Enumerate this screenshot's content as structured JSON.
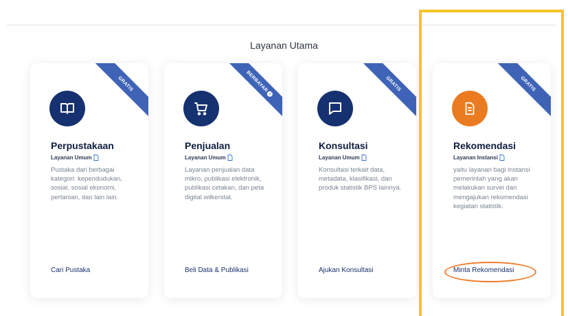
{
  "section": {
    "title": "Layanan Utama"
  },
  "colors": {
    "ribbon": "#3e63b7",
    "navy": "#163170",
    "orange": "#ea7b20",
    "highlight": "#f5c426",
    "annotation": "#ee7d2c"
  },
  "cards": [
    {
      "ribbon": "GRATIS",
      "icon": "book-icon",
      "title": "Perpustakaan",
      "subtitle": "Layanan Umum",
      "description": "Pustaka dari berbagai kategori: kependudukan, sosial, sosial ekonomi, pertanian, dan lain lain.",
      "link": "Cari Pustaka"
    },
    {
      "ribbon": "BERBAYAR",
      "icon": "cart-icon",
      "title": "Penjualan",
      "subtitle": "Layanan Umum",
      "description": "Layanan penjualan data mikro, publikasi elektronik, publikasi cetakan, dan peta digital wilkerstat.",
      "link": "Beli Data & Publikasi"
    },
    {
      "ribbon": "GRATIS",
      "icon": "chat-icon",
      "title": "Konsultasi",
      "subtitle": "Layanan Umum",
      "description": "Konsultasi terkait data, metadata, klasifikasi, dan produk statistik BPS lainnya.",
      "link": "Ajukan Konsultasi"
    },
    {
      "ribbon": "GRATIS",
      "icon": "document-icon",
      "title": "Rekomendasi",
      "subtitle": "Layanan Instansi",
      "description": "yaitu layanan bagi instansi pemerintah yang akan melakukan survei dan mengajukan rekomendasi kegiatan statistik.",
      "link": "Minta Rekomendasi"
    }
  ]
}
